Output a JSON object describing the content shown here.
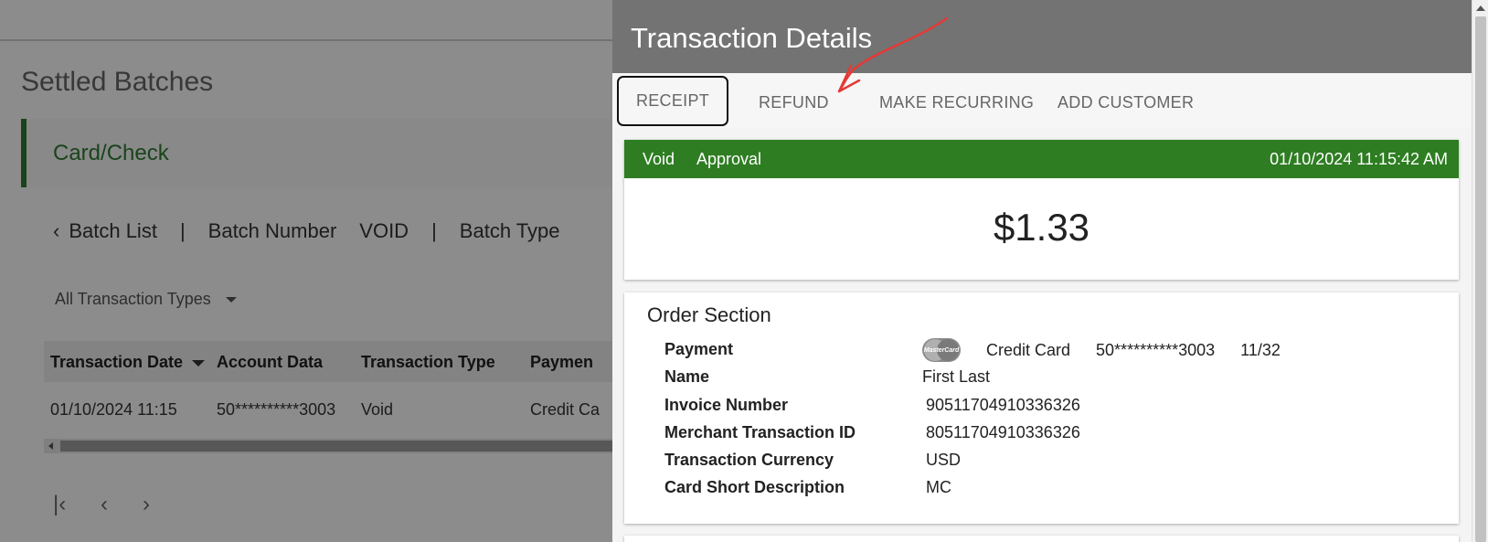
{
  "background": {
    "page_title": "Settled Batches",
    "tab_label": "Card/Check",
    "breadcrumb": {
      "back_label": "Batch List",
      "separator": "|",
      "batch_number_label": "Batch Number",
      "batch_number_value": "VOID",
      "batch_type_label": "Batch Type"
    },
    "filter": {
      "selected": "All Transaction Types"
    },
    "table": {
      "headers": [
        "Transaction Date",
        "Account Data",
        "Transaction Type",
        "Paymen"
      ],
      "rows": [
        [
          "01/10/2024 11:15",
          "50**********3003",
          "Void",
          "Credit Ca"
        ]
      ]
    },
    "pager": {
      "first": "|‹",
      "prev": "‹",
      "next": "›"
    }
  },
  "drawer": {
    "title": "Transaction Details",
    "actions": {
      "receipt": "RECEIPT",
      "refund": "REFUND",
      "make_recurring": "MAKE RECURRING",
      "add_customer": "ADD CUSTOMER"
    },
    "status": {
      "type": "Void",
      "result": "Approval",
      "timestamp": "01/10/2024 11:15:42 AM",
      "color": "#2e7d22"
    },
    "amount": "$1.33",
    "order": {
      "title": "Order Section",
      "payment_label": "Payment",
      "card_brand": "MasterCard",
      "payment_method": "Credit Card",
      "account_masked": "50**********3003",
      "expiry": "11/32",
      "name_label": "Name",
      "name_value": "First Last",
      "invoice_label": "Invoice Number",
      "invoice_value": "90511704910336326",
      "merchant_txn_label": "Merchant Transaction ID",
      "merchant_txn_value": "80511704910336326",
      "currency_label": "Transaction Currency",
      "currency_value": "USD",
      "card_desc_label": "Card Short Description",
      "card_desc_value": "MC"
    }
  },
  "annotation": {
    "type": "red-arrow",
    "target": "refund-button",
    "color": "#e53935"
  }
}
